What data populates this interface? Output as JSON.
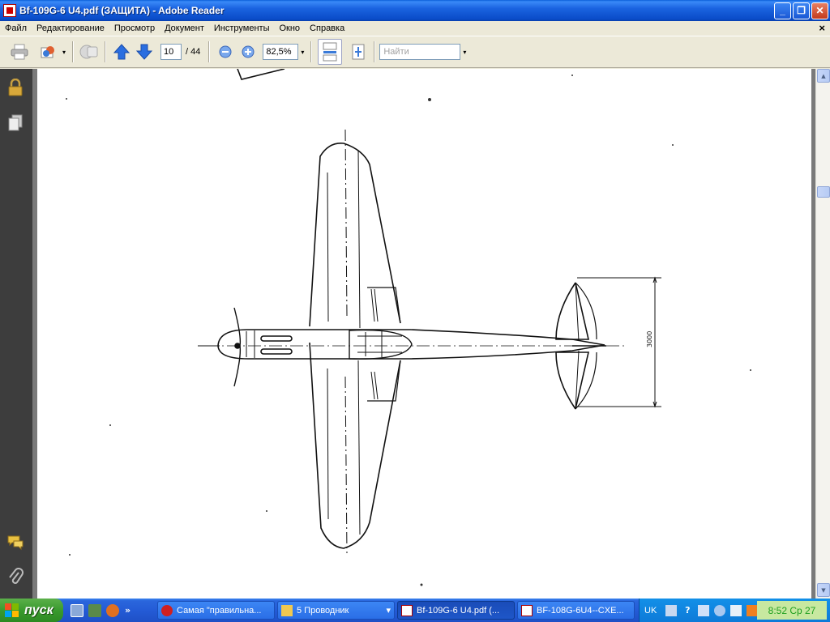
{
  "window": {
    "title": "Bf-109G-6 U4.pdf (ЗАЩИТА) - Adobe Reader",
    "minimize_glyph": "_",
    "maximize_glyph": "❐",
    "close_glyph": "✕"
  },
  "menu": {
    "items": [
      "Файл",
      "Редактирование",
      "Просмотр",
      "Документ",
      "Инструменты",
      "Окно",
      "Справка"
    ],
    "doc_close_glyph": "×"
  },
  "toolbar": {
    "current_page": "10",
    "page_total": "/  44",
    "zoom_value": "82,5%",
    "find_placeholder": "Найти",
    "dropdown_glyph": "▾"
  },
  "drawing": {
    "dimension_label": "3000"
  },
  "scrollbar": {
    "up_glyph": "▲",
    "down_glyph": "▼"
  },
  "taskbar": {
    "start_label": "пуск",
    "more_glyph": "»",
    "tasks": [
      {
        "label": "Самая \"правильна...",
        "active": false
      },
      {
        "label": "5 Проводник",
        "active": false
      },
      {
        "label": "Bf-109G-6 U4.pdf (...",
        "active": true
      },
      {
        "label": "BF-108G-6U4--CXE...",
        "active": false
      }
    ],
    "group_arrow": "▾",
    "tray_lang": "UK",
    "clock": "8:52 Ср 27"
  },
  "colors": {
    "titlebar": "#1a63e0",
    "taskbar": "#245bd6",
    "start_green": "#3a9a2e",
    "nav_dark": "#3d3d3d",
    "clock_text": "#20a020"
  }
}
